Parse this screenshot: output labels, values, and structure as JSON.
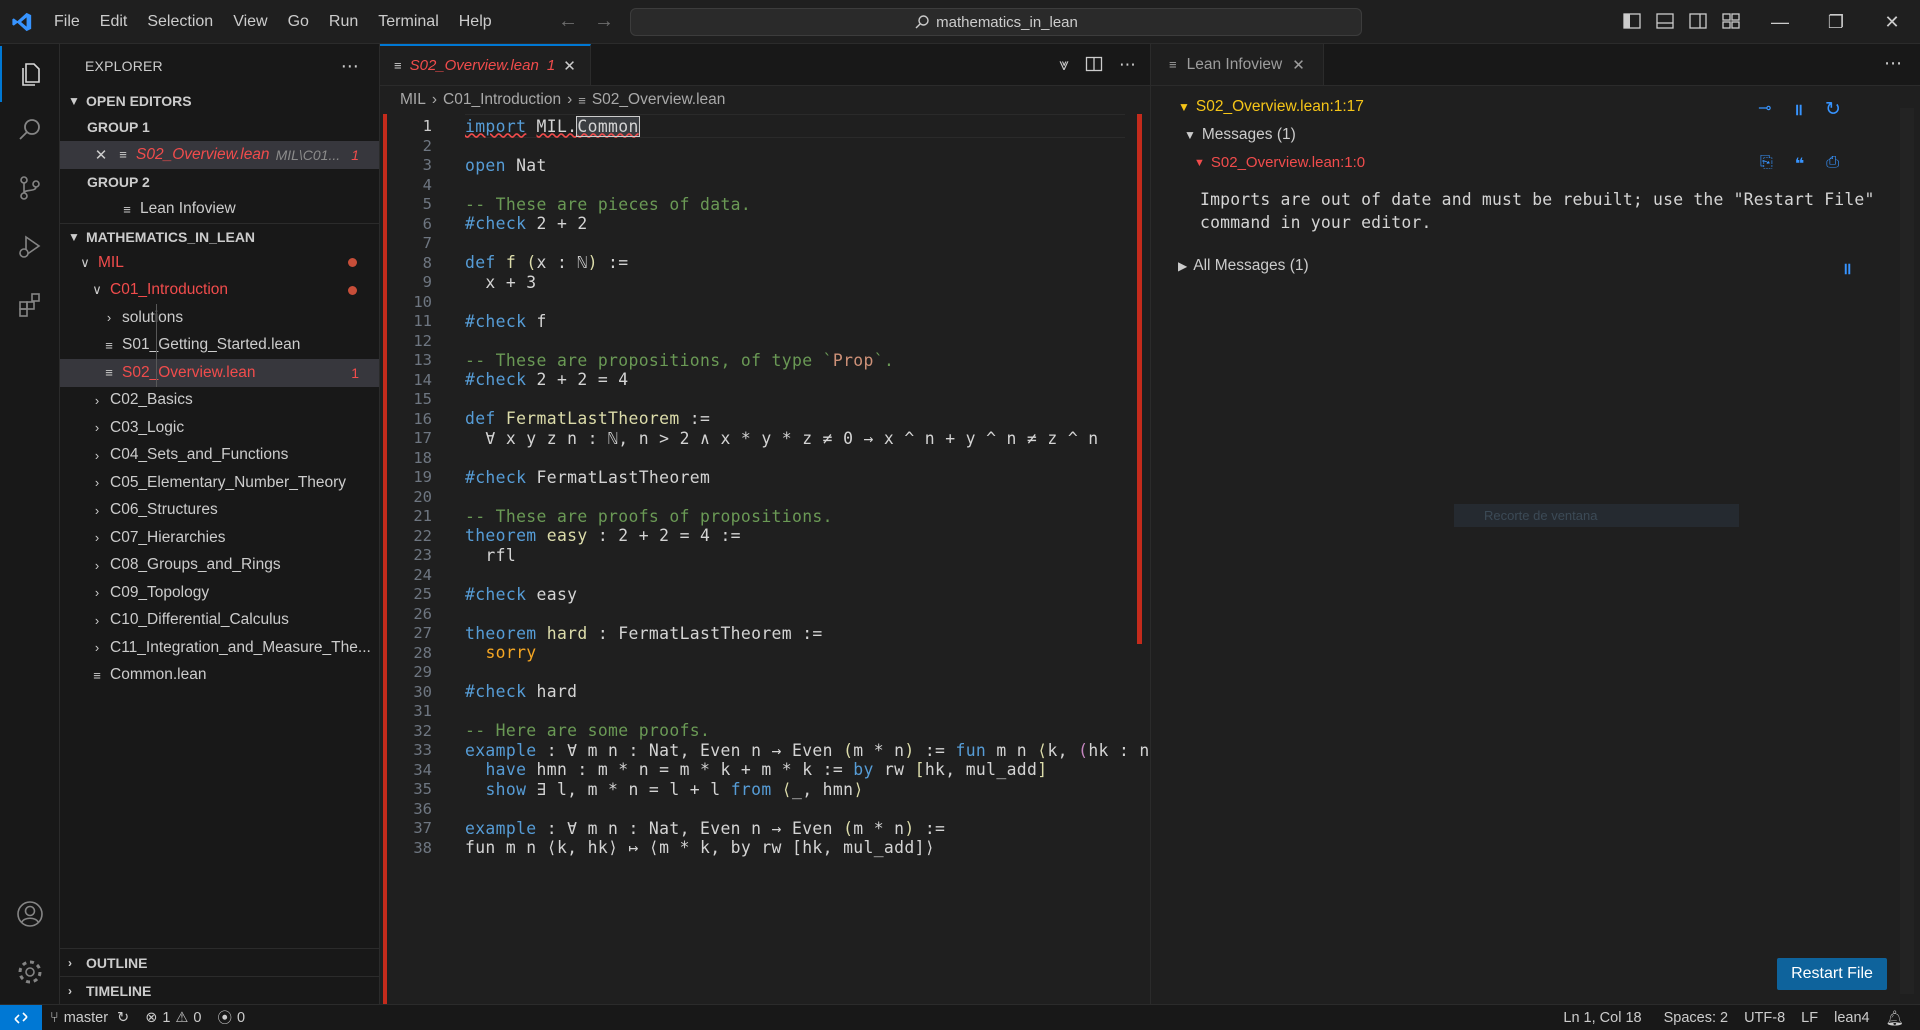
{
  "menu": [
    "File",
    "Edit",
    "Selection",
    "View",
    "Go",
    "Run",
    "Terminal",
    "Help"
  ],
  "command_center": "mathematics_in_lean",
  "sidebar": {
    "title": "EXPLORER",
    "open_editors": "OPEN EDITORS",
    "group1": "GROUP 1",
    "group1_file": "S02_Overview.lean",
    "group1_desc": "MIL\\C01...",
    "group1_badge": "1",
    "group2": "GROUP 2",
    "group2_file": "Lean Infoview",
    "workspace": "MATHEMATICS_IN_LEAN",
    "tree": [
      {
        "label": "MIL"
      },
      {
        "label": "C01_Introduction"
      },
      {
        "label": "solutions"
      },
      {
        "label": "S01_Getting_Started.lean"
      },
      {
        "label": "S02_Overview.lean",
        "badge": "1"
      },
      {
        "label": "C02_Basics"
      },
      {
        "label": "C03_Logic"
      },
      {
        "label": "C04_Sets_and_Functions"
      },
      {
        "label": "C05_Elementary_Number_Theory"
      },
      {
        "label": "C06_Structures"
      },
      {
        "label": "C07_Hierarchies"
      },
      {
        "label": "C08_Groups_and_Rings"
      },
      {
        "label": "C09_Topology"
      },
      {
        "label": "C10_Differential_Calculus"
      },
      {
        "label": "C11_Integration_and_Measure_The..."
      },
      {
        "label": "Common.lean"
      }
    ],
    "outline": "OUTLINE",
    "timeline": "TIMELINE"
  },
  "editor": {
    "tab_label": "S02_Overview.lean",
    "tab_badge": "1",
    "breadcrumbs": [
      "MIL",
      "C01_Introduction",
      "S02_Overview.lean"
    ]
  },
  "infoview": {
    "tab_label": "Lean Infoview",
    "location": "S02_Overview.lean:1:17",
    "messages_header": "Messages (1)",
    "message_location": "S02_Overview.lean:1:0",
    "message_line1": "Imports are out of date and must be rebuilt; use the \"Restart File\"",
    "message_line2": "command in your editor.",
    "all_messages": "All Messages (1)",
    "restart_button": "Restart File",
    "ghost_tooltip": "Recorte de ventana"
  },
  "status": {
    "branch": "master",
    "errors": "1",
    "warnings": "0",
    "ports": "0",
    "position": "Ln 1, Col 18",
    "spaces": "Spaces: 2",
    "encoding": "UTF-8",
    "eol": "LF",
    "language": "lean4"
  },
  "colors": {
    "accent": "#0078d4",
    "error": "#f14c4c",
    "warning": "#f5c518",
    "keyword": "#569cd6",
    "comment": "#6a9955"
  },
  "code_lines": [
    "import MIL.Common",
    "",
    "open Nat",
    "",
    "-- These are pieces of data.",
    "#check 2 + 2",
    "",
    "def f (x : ℕ) :=",
    "  x + 3",
    "",
    "#check f",
    "",
    "-- These are propositions, of type `Prop`.",
    "#check 2 + 2 = 4",
    "",
    "def FermatLastTheorem :=",
    "  ∀ x y z n : ℕ, n > 2 ∧ x * y * z ≠ 0 → x ^ n + y ^ n ≠ z ^ n",
    "",
    "#check FermatLastTheorem",
    "",
    "-- These are proofs of propositions.",
    "theorem easy : 2 + 2 = 4 :=",
    "  rfl",
    "",
    "#check easy",
    "",
    "theorem hard : FermatLastTheorem :=",
    "  sorry",
    "",
    "#check hard",
    "",
    "-- Here are some proofs.",
    "example : ∀ m n : Nat, Even n → Even (m * n) := fun m n ⟨k, (hk : n = k",
    "  have hmn : m * n = m * k + m * k := by rw [hk, mul_add]",
    "  show ∃ l, m * n = l + l from ⟨_, hmn⟩",
    "",
    "example : ∀ m n : Nat, Even n → Even (m * n) :=",
    "fun m n ⟨k, hk⟩ ↦ ⟨m * k, by rw [hk, mul_add]⟩"
  ]
}
